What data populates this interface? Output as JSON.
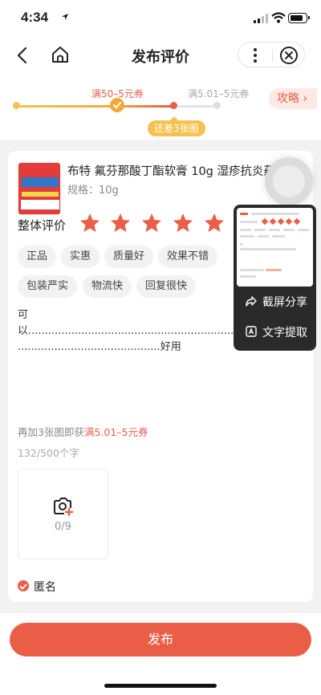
{
  "status_bar": {
    "time": "4:34"
  },
  "nav": {
    "title": "发布评价"
  },
  "progress": {
    "milestone_1": "满50–5元券",
    "milestone_2": "满5.01–5元券",
    "gap_tag": "还差3张图",
    "guide_label": "攻略 ›"
  },
  "product": {
    "title": "布特 氟芬那酸丁酯软膏 10g 湿疹抗炎药物",
    "spec": "规格：10g"
  },
  "rating": {
    "label": "整体评价",
    "stars": 5,
    "max": 5,
    "star_color": "#e8604a"
  },
  "tags": [
    "正品",
    "实惠",
    "质量好",
    "效果不错",
    "包装严实",
    "物流快",
    "回复很快"
  ],
  "review": {
    "text": "可\n以.......................................................................\n...........................................好用"
  },
  "bonus": {
    "prefix": "再加3张图即获",
    "highlight": "满5.01–5元券"
  },
  "char_count": "132/500个字",
  "upload": {
    "count": "0/9",
    "icon": "camera-add-icon"
  },
  "anonymous": {
    "label": "匿名",
    "checked": true
  },
  "float_menu": {
    "share": "截屏分享",
    "extract": "文字提取"
  },
  "publish_label": "发布",
  "colors": {
    "accent": "#ea5e47",
    "progress_yellow": "#f2a93b",
    "gap_tag": "#f6c14f"
  }
}
